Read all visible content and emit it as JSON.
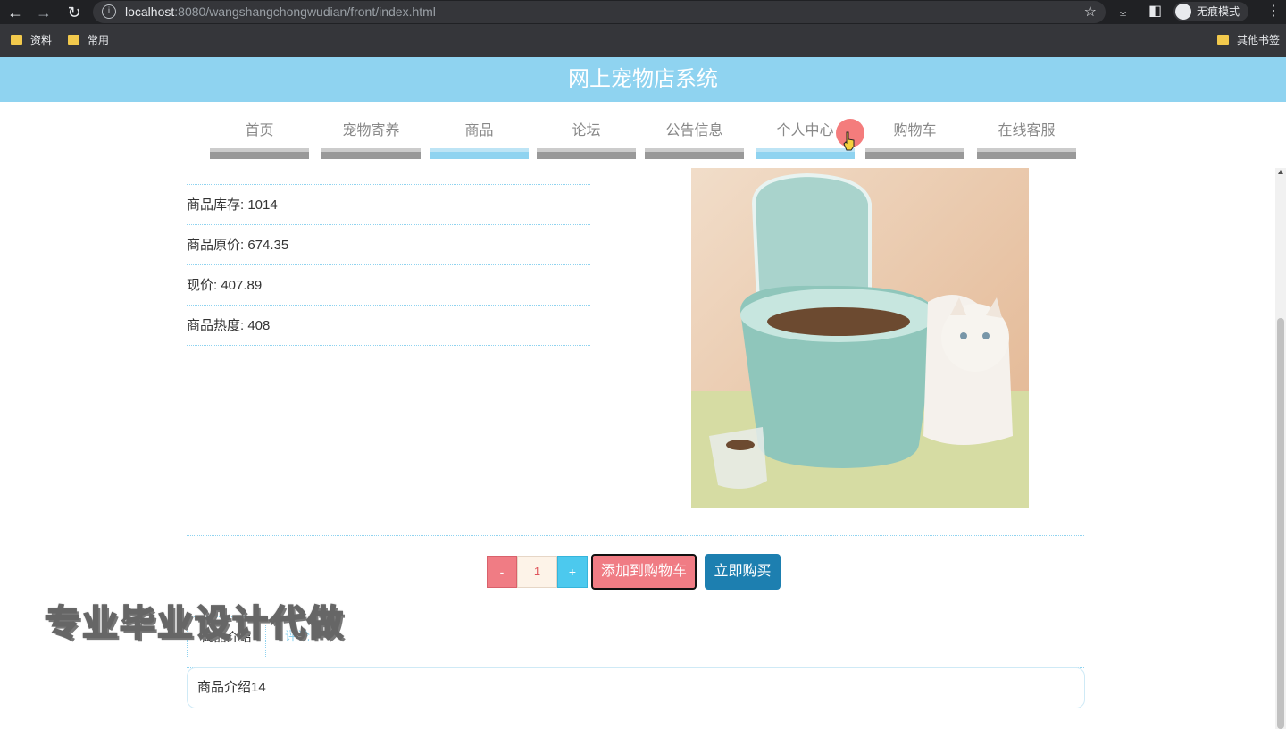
{
  "browser": {
    "url_host": "localhost",
    "url_rest": ":8080/wangshangchongwudian/front/index.html",
    "incognito_label": "无痕模式",
    "bookmarks": [
      "资料",
      "常用"
    ],
    "other_bookmarks": "其他书签"
  },
  "site": {
    "title": "网上宠物店系统"
  },
  "menu": {
    "items": [
      {
        "label": "首页",
        "active": false
      },
      {
        "label": "宠物寄养",
        "active": false
      },
      {
        "label": "商品",
        "active": true
      },
      {
        "label": "论坛",
        "active": false
      },
      {
        "label": "公告信息",
        "active": false
      },
      {
        "label": "个人中心",
        "active": true
      },
      {
        "label": "购物车",
        "active": false
      },
      {
        "label": "在线客服",
        "active": false
      }
    ]
  },
  "product": {
    "stock": "商品库存: 1014",
    "original_price": "商品原价: 674.35",
    "current_price": "现价: 407.89",
    "popularity": "商品热度: 408",
    "image_alt": "pet food storage bin with cat"
  },
  "purchase": {
    "minus_label": "-",
    "quantity": "1",
    "plus_label": "+",
    "add_to_cart_label": "添加到购物车",
    "buy_now_label": "立即购买"
  },
  "tabs": {
    "intro_label": "商品介绍",
    "comment_label": "评论"
  },
  "intro_text": "商品介绍14",
  "watermark": "专业毕业设计代做",
  "colors": {
    "header": "#8fd3f0",
    "cart_button": "#f07c84",
    "buy_button": "#1d7fb0",
    "plus_button": "#4cc9ee"
  }
}
